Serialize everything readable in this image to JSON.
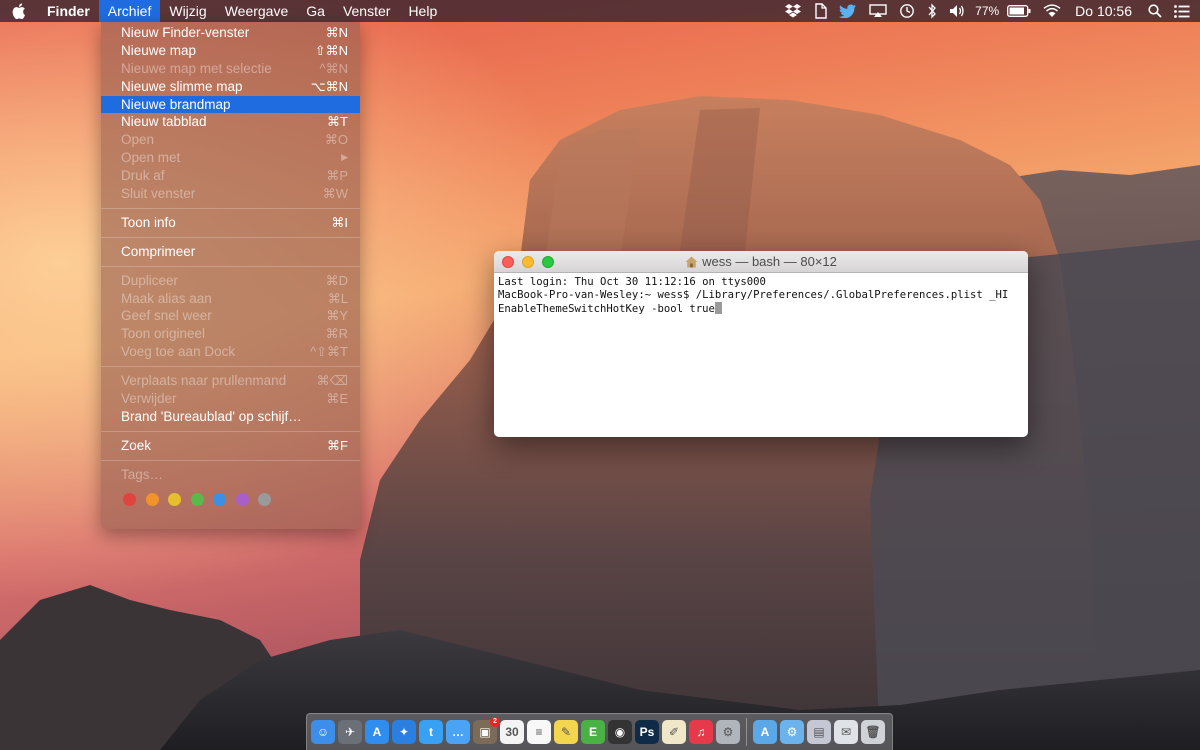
{
  "menubar": {
    "app_name": "Finder",
    "menus": [
      "Archief",
      "Wijzig",
      "Weergave",
      "Ga",
      "Venster",
      "Help"
    ],
    "active_menu": "Archief",
    "status": {
      "battery_percent": "77%",
      "clock": "Do 10:56",
      "icons": [
        "dropbox-icon",
        "evernote-icon",
        "twitter-icon",
        "airplay-icon",
        "time-machine-icon",
        "bluetooth-icon",
        "volume-icon",
        "battery-icon",
        "wifi-icon",
        "spotlight-icon",
        "notification-center-icon"
      ]
    }
  },
  "archief_menu": {
    "items": [
      {
        "label": "Nieuw Finder-venster",
        "shortcut": "⌘N",
        "disabled": false
      },
      {
        "label": "Nieuwe map",
        "shortcut": "⇧⌘N",
        "disabled": false
      },
      {
        "label": "Nieuwe map met selectie",
        "shortcut": "^⌘N",
        "disabled": true
      },
      {
        "label": "Nieuwe slimme map",
        "shortcut": "⌥⌘N",
        "disabled": false
      },
      {
        "label": "Nieuwe brandmap",
        "shortcut": "",
        "disabled": false,
        "highlighted": true
      },
      {
        "label": "Nieuw tabblad",
        "shortcut": "⌘T",
        "disabled": false
      },
      {
        "label": "Open",
        "shortcut": "⌘O",
        "disabled": true
      },
      {
        "label": "Open met",
        "shortcut": "▶",
        "disabled": true
      },
      {
        "label": "Druk af",
        "shortcut": "⌘P",
        "disabled": true
      },
      {
        "label": "Sluit venster",
        "shortcut": "⌘W",
        "disabled": true
      },
      {
        "separator": true
      },
      {
        "label": "Toon info",
        "shortcut": "⌘I",
        "disabled": false
      },
      {
        "separator": true
      },
      {
        "label": "Comprimeer",
        "shortcut": "",
        "disabled": false
      },
      {
        "separator": true
      },
      {
        "label": "Dupliceer",
        "shortcut": "⌘D",
        "disabled": true
      },
      {
        "label": "Maak alias aan",
        "shortcut": "⌘L",
        "disabled": true
      },
      {
        "label": "Geef snel weer",
        "shortcut": "⌘Y",
        "disabled": true
      },
      {
        "label": "Toon origineel",
        "shortcut": "⌘R",
        "disabled": true
      },
      {
        "label": "Voeg toe aan Dock",
        "shortcut": "^⇧⌘T",
        "disabled": true
      },
      {
        "separator": true
      },
      {
        "label": "Verplaats naar prullenmand",
        "shortcut": "⌘⌫",
        "disabled": true
      },
      {
        "label": "Verwijder",
        "shortcut": "⌘E",
        "disabled": true
      },
      {
        "label": "Brand 'Bureaublad' op schijf…",
        "shortcut": "",
        "disabled": false
      },
      {
        "separator": true
      },
      {
        "label": "Zoek",
        "shortcut": "⌘F",
        "disabled": false
      },
      {
        "separator": true
      },
      {
        "label": "Tags…",
        "shortcut": "",
        "disabled": true
      }
    ],
    "tag_colors": [
      "#e0443e",
      "#f0932b",
      "#e5c02c",
      "#5cb84a",
      "#3d8fe0",
      "#a85fc9",
      "#9a9a9a"
    ]
  },
  "terminal": {
    "title": "wess — bash — 80×12",
    "lines": [
      "Last login: Thu Oct 30 11:12:16 on ttys000",
      "MacBook-Pro-van-Wesley:~ wess$ /Library/Preferences/.GlobalPreferences.plist _HI",
      "EnableThemeSwitchHotKey -bool true"
    ]
  },
  "dock": {
    "apps": [
      {
        "name": "finder-icon",
        "color": "#3c8ee8",
        "glyph": "☺"
      },
      {
        "name": "launchpad-icon",
        "color": "#6b6f78",
        "glyph": "✈"
      },
      {
        "name": "app-store-icon",
        "color": "#2f8df0",
        "glyph": "A"
      },
      {
        "name": "safari-icon",
        "color": "#2a7fe0",
        "glyph": "✦"
      },
      {
        "name": "twitter-icon",
        "color": "#38a1f3",
        "glyph": "t"
      },
      {
        "name": "messages-icon",
        "color": "#4aa3f5",
        "glyph": "…"
      },
      {
        "name": "preview-icon",
        "color": "#7d6b59",
        "glyph": "▣",
        "badge": "2"
      },
      {
        "name": "calendar-icon",
        "color": "#f4f4f4",
        "glyph": "30"
      },
      {
        "name": "reminders-icon",
        "color": "#f8f8f8",
        "glyph": "≡"
      },
      {
        "name": "notes-icon",
        "color": "#f3d54e",
        "glyph": "✎"
      },
      {
        "name": "evernote-icon",
        "color": "#4ab244",
        "glyph": "E"
      },
      {
        "name": "camera-app-icon",
        "color": "#333333",
        "glyph": "◉"
      },
      {
        "name": "photoshop-icon",
        "color": "#0f2b47",
        "glyph": "Ps"
      },
      {
        "name": "textedit-icon",
        "color": "#f0e7c8",
        "glyph": "✐"
      },
      {
        "name": "itunes-icon",
        "color": "#e63949",
        "glyph": "♫"
      },
      {
        "name": "disk-utility-icon",
        "color": "#b0b4bb",
        "glyph": "⚙"
      }
    ],
    "stacks": [
      {
        "name": "applications-folder-icon",
        "color": "#5aa8e8",
        "glyph": "A"
      },
      {
        "name": "documents-folder-icon",
        "color": "#6cb3ee",
        "glyph": "⚙"
      },
      {
        "name": "downloads-stack-icon",
        "color": "#c5c8d4",
        "glyph": "▤"
      },
      {
        "name": "mail-stack-icon",
        "color": "#dfe2e6",
        "glyph": "✉"
      },
      {
        "name": "trash-icon",
        "color": "#cfd2d6",
        "glyph": "🗑"
      }
    ]
  }
}
